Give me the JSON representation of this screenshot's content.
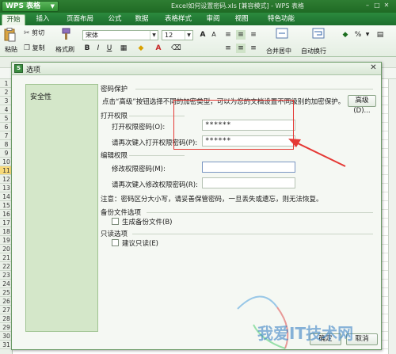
{
  "app": {
    "menu_label": "WPS 表格",
    "doc_title": "Excel如何设置密码.xls [兼容模式] - WPS 表格"
  },
  "ribbon_tabs": [
    "开始",
    "插入",
    "页面布局",
    "公式",
    "数据",
    "表格样式",
    "审阅",
    "视图",
    "特色功能"
  ],
  "ribbon": {
    "paste_label": "粘贴",
    "cut_label": "剪切",
    "copy_label": "复制",
    "format_painter_label": "格式刷",
    "font_name": "宋体",
    "font_size": "12",
    "merge_label": "合并居中",
    "wrap_label": "自动换行",
    "percent_label": "%"
  },
  "sheet": {
    "row_numbers": [
      "1",
      "2",
      "3",
      "4",
      "5",
      "6",
      "7",
      "8",
      "9",
      "10",
      "11",
      "12",
      "13",
      "14",
      "15",
      "16",
      "17",
      "18",
      "19",
      "20",
      "21",
      "22",
      "23",
      "24",
      "25",
      "26",
      "27",
      "28",
      "29",
      "30",
      "31"
    ],
    "selected_row": "11"
  },
  "dialog": {
    "title": "选项",
    "sidebar_item": "安全性",
    "section_password": "密码保护",
    "hint_text": "点击“高级”按钮选择不同的加密类型，可以为您的文档设置不同级别的加密保护。",
    "advanced_button": "高级(D)...",
    "open_permission": "打开权限",
    "open_password_label": "打开权限密码(O):",
    "open_password_value": "******",
    "reenter_open_label": "请再次键入打开权限密码(P):",
    "reenter_open_value": "******",
    "edit_permission": "编辑权限",
    "edit_password_label": "修改权限密码(M):",
    "edit_password_value": "",
    "reenter_edit_label": "请再次键入修改权限密码(R):",
    "reenter_edit_value": "",
    "note_text": "注意：密码区分大小写，请妥善保管密码，一旦丢失或遗忘，则无法恢复。",
    "backup_section": "备份文件选项",
    "backup_checkbox": "生成备份文件(B)",
    "readonly_section": "只读选项",
    "readonly_checkbox": "建议只读(E)",
    "ok_button": "确定",
    "cancel_button": "取消"
  },
  "watermark_text": "我爱IT技术网",
  "colors": {
    "title_green": "#2e7d32",
    "sidebar_green": "#d4e7c9",
    "annotation_red": "#e53935"
  }
}
